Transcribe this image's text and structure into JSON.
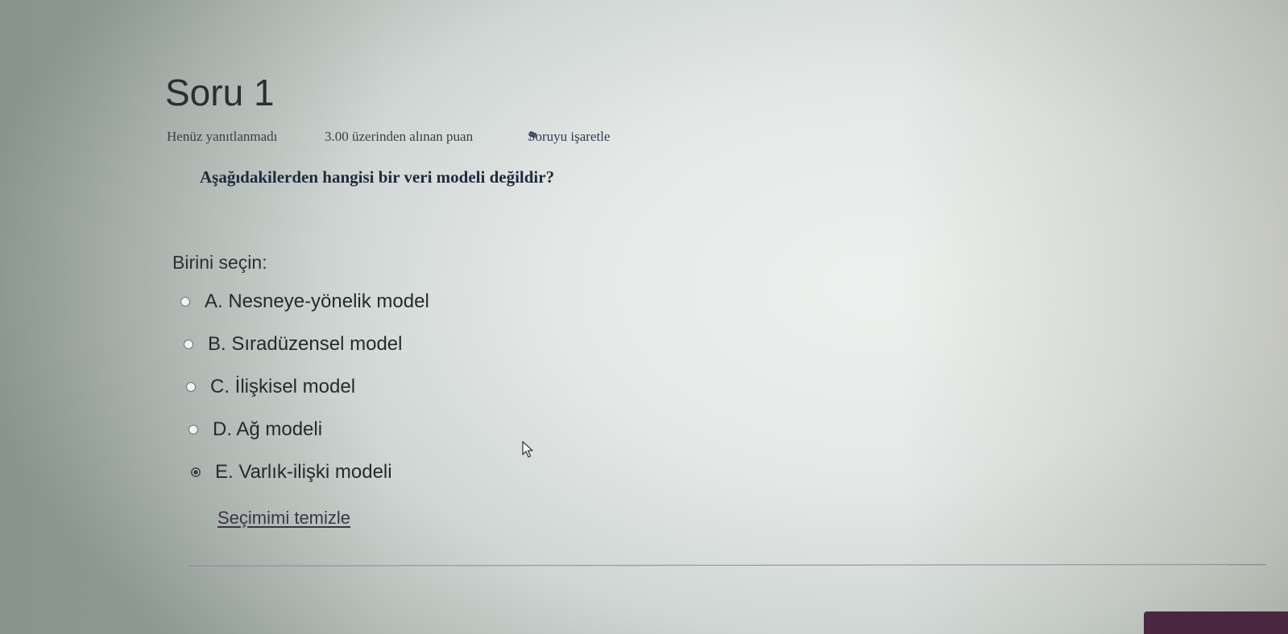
{
  "question": {
    "title": "Soru 1",
    "state": "Henüz yanıtlanmadı",
    "grade": "3.00 üzerinden alınan puan",
    "flag_label": "Soruyu işaretle",
    "text": "Aşağıdakilerden hangisi bir veri modeli değildir?"
  },
  "answers": {
    "prompt": "Birini seçin:",
    "options": [
      {
        "label": "A. Nesneye-yönelik model",
        "selected": false
      },
      {
        "label": "B. Sıradüzensel model",
        "selected": false
      },
      {
        "label": "C. İlişkisel model",
        "selected": false
      },
      {
        "label": "D. Ağ modeli",
        "selected": false
      },
      {
        "label": "E. Varlık-ilişki modeli",
        "selected": true
      }
    ],
    "clear_label": "Seçimimi temizle"
  },
  "icons": {
    "flag": "flag-icon",
    "cursor": "mouse-pointer-icon"
  }
}
